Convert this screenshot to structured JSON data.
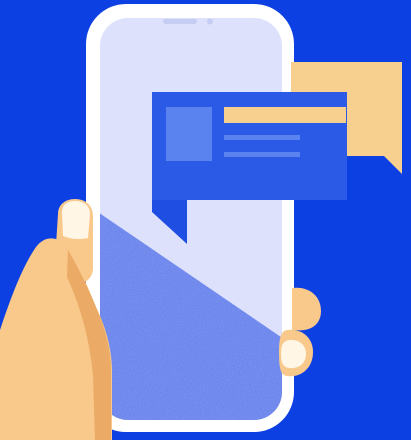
{
  "colors": {
    "background": "#0d40e2",
    "phone_frame": "#ffffff",
    "phone_screen": "#dde1fb",
    "screen_shadow": "#5b78ea",
    "card_blue": "#2a5ae6",
    "card_blue_dark": "#1846d9",
    "card_thumb": "#5b83ef",
    "bubble_tan": "#f7cf8f",
    "skin": "#f8c98b",
    "skin_shadow": "#e9a45f",
    "nail": "#fff6e6"
  },
  "icons": {
    "phone": "smartphone-icon",
    "chat_card": "message-card-icon",
    "tan_bubble": "speech-bubble-icon",
    "hand": "hand-illustration"
  }
}
